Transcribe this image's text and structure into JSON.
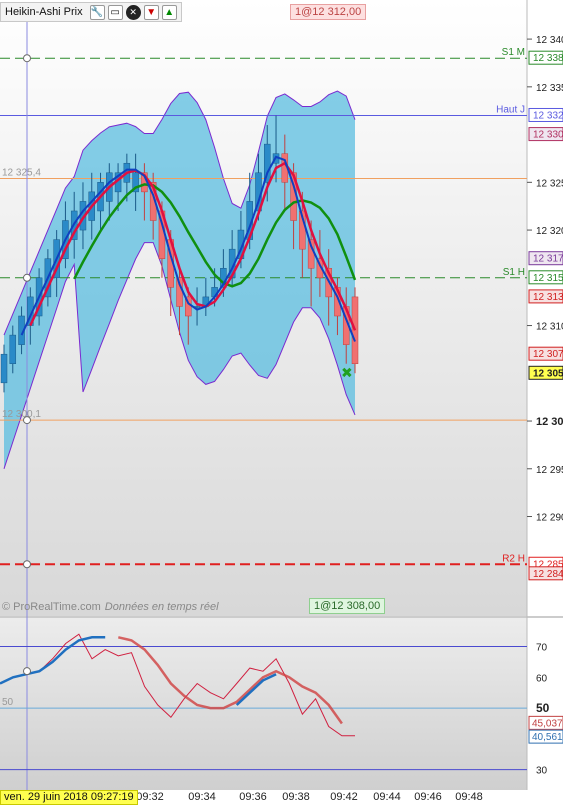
{
  "window": {
    "title": "Heikin-Ashi Prix",
    "icons": [
      "wrench-icon",
      "window-icon",
      "close-icon",
      "arrow-down-icon",
      "arrow-up-icon"
    ]
  },
  "badges": {
    "top": "1@12 312,00",
    "bottom": "1@12 308,00"
  },
  "copyright": {
    "brand": "© ProRealTime.com",
    "realtime": "Données en temps réel"
  },
  "chart_data": [
    {
      "type": "candlestick",
      "title": "Heikin-Ashi Prix",
      "time_ticks": [
        "09:32",
        "09:34",
        "09:36",
        "09:38",
        "09:42",
        "09:44",
        "09:46",
        "09:48"
      ],
      "cursor_date": "ven. 29 juin 2018 09:27:19",
      "y_ticks": [
        "12 340",
        "12 335",
        "12 325",
        "12 320",
        "12 310",
        "12 30",
        "12 295",
        "12 290"
      ],
      "ylim": [
        12280,
        12342
      ],
      "levels": [
        {
          "label": "S1 M",
          "value": 12338,
          "tag": "12 338",
          "color": "#2a8a2a",
          "style": "dashed"
        },
        {
          "label": "Haut J",
          "value": 12332,
          "tag": "12 332",
          "color": "#5a5ae0",
          "style": "solid"
        },
        {
          "label": "",
          "value": 12325.4,
          "tag": "12 325,4",
          "color": "#f0a060",
          "style": "solid"
        },
        {
          "label": "S1 H",
          "value": 12315,
          "tag": "12 315",
          "color": "#2a8a2a",
          "style": "dashed"
        },
        {
          "label": "",
          "value": 12300.1,
          "tag": "12 300,1",
          "color": "#f0a060",
          "style": "solid"
        },
        {
          "label": "R2 H",
          "value": 12285,
          "tag": "12 285",
          "color": "#e02020",
          "style": "dashed"
        }
      ],
      "price_tags": [
        {
          "text": "12 330",
          "value": 12330,
          "color": "#b03060",
          "bg": "#efe6f0"
        },
        {
          "text": "12 317",
          "value": 12317,
          "color": "#7a3a9a",
          "bg": "#efe6f0"
        },
        {
          "text": "12 313",
          "value": 12313,
          "color": "#d02020",
          "bg": "#f7e0e0"
        },
        {
          "text": "12 307",
          "value": 12307,
          "color": "#d02020",
          "bg": "#f7e0e0"
        },
        {
          "text": "12 305",
          "value": 12305,
          "color": "#222222",
          "bg": "#ffff50"
        },
        {
          "text": "12 284",
          "value": 12284,
          "color": "#d02020",
          "bg": "#f7e0e0"
        }
      ],
      "candles": [
        {
          "o": 12304,
          "c": 12307,
          "h": 12308,
          "l": 12303
        },
        {
          "o": 12306,
          "c": 12309,
          "h": 12310,
          "l": 12305
        },
        {
          "o": 12308,
          "c": 12311,
          "h": 12312,
          "l": 12307
        },
        {
          "o": 12310,
          "c": 12313,
          "h": 12314,
          "l": 12308
        },
        {
          "o": 12311,
          "c": 12315,
          "h": 12316,
          "l": 12310
        },
        {
          "o": 12313,
          "c": 12317,
          "h": 12318,
          "l": 12312
        },
        {
          "o": 12315,
          "c": 12319,
          "h": 12320,
          "l": 12313
        },
        {
          "o": 12317,
          "c": 12321,
          "h": 12323,
          "l": 12316
        },
        {
          "o": 12319,
          "c": 12322,
          "h": 12324,
          "l": 12317
        },
        {
          "o": 12320,
          "c": 12323,
          "h": 12325,
          "l": 12318
        },
        {
          "o": 12321,
          "c": 12324,
          "h": 12326,
          "l": 12319
        },
        {
          "o": 12322,
          "c": 12325,
          "h": 12326,
          "l": 12320
        },
        {
          "o": 12323,
          "c": 12326,
          "h": 12327,
          "l": 12321
        },
        {
          "o": 12324,
          "c": 12326,
          "h": 12327,
          "l": 12322
        },
        {
          "o": 12325,
          "c": 12327,
          "h": 12328,
          "l": 12323
        },
        {
          "o": 12324,
          "c": 12326,
          "h": 12328,
          "l": 12322
        },
        {
          "o": 12326,
          "c": 12324,
          "h": 12327,
          "l": 12321
        },
        {
          "o": 12325,
          "c": 12321,
          "h": 12326,
          "l": 12319
        },
        {
          "o": 12322,
          "c": 12317,
          "h": 12323,
          "l": 12315
        },
        {
          "o": 12319,
          "c": 12314,
          "h": 12320,
          "l": 12311
        },
        {
          "o": 12315,
          "c": 12312,
          "h": 12316,
          "l": 12309
        },
        {
          "o": 12313,
          "c": 12311,
          "h": 12314,
          "l": 12308
        },
        {
          "o": 12312,
          "c": 12312,
          "h": 12314,
          "l": 12310
        },
        {
          "o": 12312,
          "c": 12313,
          "h": 12315,
          "l": 12311
        },
        {
          "o": 12313,
          "c": 12314,
          "h": 12316,
          "l": 12312
        },
        {
          "o": 12314,
          "c": 12316,
          "h": 12318,
          "l": 12313
        },
        {
          "o": 12315,
          "c": 12318,
          "h": 12320,
          "l": 12314
        },
        {
          "o": 12317,
          "c": 12320,
          "h": 12322,
          "l": 12316
        },
        {
          "o": 12319,
          "c": 12323,
          "h": 12326,
          "l": 12318
        },
        {
          "o": 12322,
          "c": 12326,
          "h": 12328,
          "l": 12321
        },
        {
          "o": 12325,
          "c": 12329,
          "h": 12331,
          "l": 12323
        },
        {
          "o": 12327,
          "c": 12328,
          "h": 12332,
          "l": 12325
        },
        {
          "o": 12328,
          "c": 12325,
          "h": 12330,
          "l": 12322
        },
        {
          "o": 12326,
          "c": 12321,
          "h": 12327,
          "l": 12318
        },
        {
          "o": 12322,
          "c": 12318,
          "h": 12324,
          "l": 12315
        },
        {
          "o": 12319,
          "c": 12316,
          "h": 12321,
          "l": 12312
        },
        {
          "o": 12317,
          "c": 12315,
          "h": 12320,
          "l": 12313
        },
        {
          "o": 12316,
          "c": 12313,
          "h": 12318,
          "l": 12310
        },
        {
          "o": 12314,
          "c": 12311,
          "h": 12315,
          "l": 12309
        },
        {
          "o": 12312,
          "c": 12308,
          "h": 12314,
          "l": 12306
        },
        {
          "o": 12313,
          "c": 12306,
          "h": 12314,
          "l": 12305
        }
      ]
    },
    {
      "type": "line",
      "title": "",
      "y_ticks": [
        "70",
        "60",
        "50",
        "30"
      ],
      "ylim": [
        25,
        77
      ],
      "levels": [
        {
          "value": 70,
          "color": "#4a4ad0"
        },
        {
          "value": 50,
          "color": "#6aaad8"
        },
        {
          "value": 30,
          "color": "#4a4ad0"
        }
      ],
      "left_label": "50",
      "value_tags": [
        {
          "text": "45,037",
          "value": 45.037,
          "color": "#c04040"
        },
        {
          "text": "40,561",
          "value": 40.561,
          "color": "#3070b0"
        }
      ],
      "series": [
        {
          "color": "#d02040",
          "values": [
            58,
            60,
            61,
            62,
            66,
            71,
            74,
            66,
            69,
            67,
            68,
            57,
            51,
            47,
            53,
            58,
            55,
            53,
            58,
            63,
            62,
            66,
            58,
            48,
            53,
            44,
            41,
            41
          ]
        },
        {
          "color": "#d04040",
          "values": [
            null,
            null,
            null,
            null,
            null,
            null,
            null,
            null,
            null,
            73,
            72,
            69,
            64,
            58,
            54,
            51,
            50,
            50,
            52,
            56,
            60,
            62,
            60,
            57,
            55,
            51,
            45,
            null
          ]
        },
        {
          "color": "#2070c0",
          "values": [
            58,
            60,
            61,
            62,
            65,
            69,
            72,
            73,
            73,
            null,
            null,
            null,
            null,
            null,
            null,
            null,
            null,
            null,
            51,
            55,
            59,
            61,
            null,
            null,
            null,
            null,
            null,
            null
          ]
        }
      ]
    }
  ]
}
